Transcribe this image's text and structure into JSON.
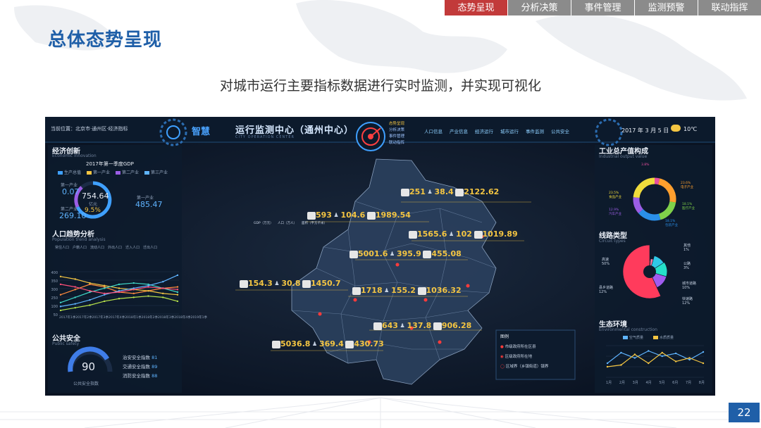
{
  "nav": {
    "tabs": [
      {
        "label": "态势呈现",
        "active": true
      },
      {
        "label": "分析决策",
        "active": false
      },
      {
        "label": "事件管理",
        "active": false
      },
      {
        "label": "监测预警",
        "active": false
      },
      {
        "label": "联动指挥",
        "active": false
      }
    ]
  },
  "slide": {
    "title": "总体态势呈现",
    "subtitle": "对城市运行主要指标数据进行实时监测，并实现可视化",
    "page_number": "22"
  },
  "dashboard": {
    "location": "当前位置：北京市·通州区·经济指标",
    "header_title": "运行监测中心（通州中心）",
    "header_prefix": "智慧",
    "header_sub": "CITY OPERATION CENTER",
    "date": "2017 年 3 月 5 日",
    "temperature": "10℃",
    "top_menu": [
      "人口信息",
      "产业信息",
      "经济运行",
      "城市运行",
      "事件监测",
      "公共安全"
    ],
    "ring_menu": [
      "态势呈现",
      "分析决策",
      "事件管理",
      "联动指挥"
    ],
    "economy": {
      "title": "经济创新",
      "subtitle": "Economic innovation",
      "chart_title": "2017年第一季度GDP",
      "legend": [
        "生产总值",
        "第一产业",
        "第二产业",
        "第三产业"
      ],
      "primary_label": "第一产业",
      "primary_value": "0.07",
      "secondary_label": "第二产业",
      "secondary_value": "269.10",
      "tertiary_label": "第一产业",
      "tertiary_value": "485.47",
      "gdp_value": "754.64",
      "gdp_unit": "亿元",
      "growth": "9.5%"
    },
    "population": {
      "title": "人口趋势分析",
      "subtitle": "Population trend analysis",
      "legend": [
        "常住人口",
        "户籍人口",
        "流动人口",
        "外出人口",
        "迁入人口",
        "迁出人口"
      ],
      "y_ticks": [
        "400",
        "350",
        "300",
        "250",
        "100",
        "50"
      ],
      "x_ticks": [
        "2017年1季",
        "2017年2季",
        "2017年3季",
        "2017年4季",
        "2018年1季",
        "2018年2季",
        "2018年3季",
        "2018年4季",
        "2019年1季"
      ]
    },
    "safety": {
      "title": "公共安全",
      "subtitle": "Public safety",
      "score": "90",
      "score_label": "公共安全指数",
      "items": [
        {
          "label": "治安安全指数",
          "value": "81"
        },
        {
          "label": "交通安全指数",
          "value": "89"
        },
        {
          "label": "消防安全指数",
          "value": "88"
        }
      ]
    },
    "map": {
      "regions": [
        {
          "gdp": "251",
          "pop": "38.4",
          "area": "2122.62"
        },
        {
          "gdp": "593",
          "pop": "104.6",
          "area": "1989.54"
        },
        {
          "gdp": "1565.6",
          "pop": "102",
          "area": "1019.89"
        },
        {
          "gdp": "5001.6",
          "pop": "395.9",
          "area": "455.08"
        },
        {
          "gdp": "154.3",
          "pop": "30.8",
          "area": "1450.7"
        },
        {
          "gdp": "1718",
          "pop": "155.2",
          "area": "1036.32"
        },
        {
          "gdp": "643",
          "pop": "137.8",
          "area": "906.28"
        },
        {
          "gdp": "5036.8",
          "pop": "369.4",
          "area": "430.73"
        }
      ],
      "gdp_label": "GDP（万元）",
      "pop_label": "人口（万人）",
      "area_label": "面积（平方千米）",
      "legend_title": "图例",
      "legend_items": [
        "市级政府所在区县",
        "区级政府所在地",
        "区域界（乡镇街道）镇界"
      ]
    },
    "industry": {
      "title": "工业总产值构成",
      "subtitle": "Industrial output value",
      "slices": [
        {
          "label": "其他",
          "value": 3.8,
          "color": "#e84fa0"
        },
        {
          "label": "电子产业",
          "value": 23.6,
          "color": "#ff9f2e"
        },
        {
          "label": "医疗产业",
          "value": 18.1,
          "color": "#7fd14a"
        },
        {
          "label": "包装产业",
          "value": 18.1,
          "color": "#2a8fe8"
        },
        {
          "label": "汽车产业",
          "value": 12.9,
          "color": "#9b5de5"
        },
        {
          "label": "食品产业",
          "value": 23.5,
          "color": "#f0dc3c"
        }
      ],
      "labels_text": [
        "3.8%",
        "23.6%\n电子产业",
        "18.1%\n医疗产业",
        "18.1%\n包装产业",
        "12.9%\n汽车产业",
        "23.5%\n食品产业"
      ]
    },
    "roads": {
      "title": "线路类型",
      "subtitle": "Circuit types",
      "slices": [
        {
          "label": "其他",
          "value": 1,
          "color": "#f6e27a"
        },
        {
          "label": "公路",
          "value": 3,
          "color": "#ff7aa8"
        },
        {
          "label": "城市道路",
          "value": 10,
          "color": "#2fc9e8"
        },
        {
          "label": "快速路",
          "value": 12,
          "color": "#25e0c9"
        },
        {
          "label": "县乡道路",
          "value": 12,
          "color": "#a05cf0"
        },
        {
          "label": "高速",
          "value": 50,
          "color": "#ff3b5c"
        }
      ],
      "labels": [
        {
          "text": "其他\n1%"
        },
        {
          "text": "公路\n3%"
        },
        {
          "text": "城市道路\n10%"
        },
        {
          "text": "快速路\n12%"
        },
        {
          "text": "县乡道路\n12%"
        },
        {
          "text": "高速\n50%"
        }
      ]
    },
    "ecology": {
      "title": "生态环境",
      "subtitle": "Environmental construction",
      "legend": [
        "空气质量",
        "水质质量"
      ],
      "x_ticks": [
        "1月",
        "2月",
        "3月",
        "4月",
        "5月",
        "6月",
        "7月",
        "8月"
      ]
    }
  },
  "chart_data": [
    {
      "type": "pie",
      "title": "工业总产值构成",
      "categories": [
        "其他",
        "电子产业",
        "医疗产业",
        "包装产业",
        "汽车产业",
        "食品产业"
      ],
      "values": [
        3.8,
        23.6,
        18.1,
        18.1,
        12.9,
        23.5
      ]
    },
    {
      "type": "pie",
      "title": "线路类型",
      "categories": [
        "其他",
        "公路",
        "城市道路",
        "快速路",
        "县乡道路",
        "高速"
      ],
      "values": [
        1,
        3,
        10,
        12,
        12,
        50
      ]
    },
    {
      "type": "line",
      "title": "人口趋势分析",
      "categories": [
        "2017年1季",
        "2017年2季",
        "2017年3季",
        "2017年4季",
        "2018年1季",
        "2018年2季",
        "2018年3季",
        "2018年4季",
        "2019年1季"
      ],
      "ylim": [
        0,
        400
      ],
      "series": [
        {
          "name": "常住人口",
          "color": "#ff8a3d",
          "values": [
            180,
            220,
            260,
            240,
            200,
            190,
            210,
            230,
            240
          ]
        },
        {
          "name": "户籍人口",
          "color": "#f4c542",
          "values": [
            320,
            300,
            270,
            250,
            230,
            220,
            210,
            190,
            180
          ]
        },
        {
          "name": "流动人口",
          "color": "#3fd6c6",
          "values": [
            120,
            160,
            200,
            230,
            260,
            270,
            260,
            230,
            200
          ]
        },
        {
          "name": "外出人口",
          "color": "#5fb4ff",
          "values": [
            90,
            110,
            140,
            180,
            210,
            230,
            250,
            280,
            330
          ]
        },
        {
          "name": "迁入人口",
          "color": "#ff4f7a",
          "values": [
            260,
            240,
            210,
            190,
            200,
            220,
            240,
            230,
            220
          ]
        },
        {
          "name": "迁出人口",
          "color": "#b7e24a",
          "values": [
            60,
            80,
            100,
            130,
            150,
            160,
            170,
            160,
            130
          ]
        }
      ]
    },
    {
      "type": "line",
      "title": "生态环境",
      "categories": [
        "1月",
        "2月",
        "3月",
        "4月",
        "5月",
        "6月",
        "7月",
        "8月"
      ],
      "ylim": [
        0,
        100
      ],
      "series": [
        {
          "name": "空气质量",
          "color": "#5fb4ff",
          "values": [
            40,
            70,
            55,
            75,
            60,
            68,
            50,
            72
          ]
        },
        {
          "name": "水质质量",
          "color": "#f4c542",
          "values": [
            30,
            35,
            65,
            40,
            70,
            45,
            55,
            40
          ]
        }
      ]
    }
  ]
}
